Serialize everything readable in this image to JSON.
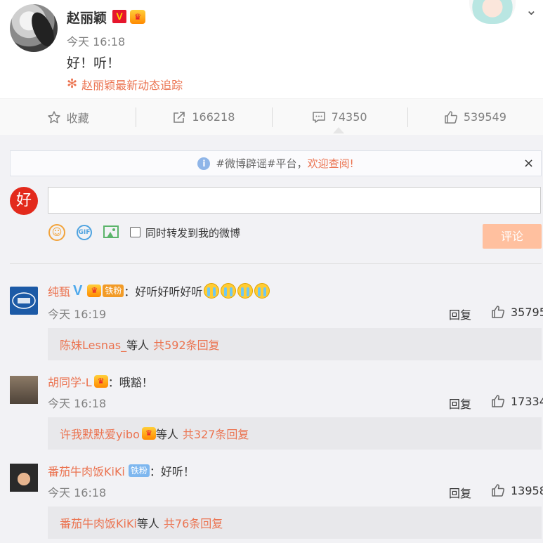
{
  "post": {
    "author": "赵丽颖",
    "v_badge": "V",
    "time": "今天 16:18",
    "text": "好！听！",
    "topic": "赵丽颖最新动态追踪"
  },
  "actions": {
    "favorite": "收藏",
    "repost": "166218",
    "comment": "74350",
    "like": "539549"
  },
  "notice": {
    "prefix": "#微博辟谣#平台，",
    "link": "欢迎查阅!",
    "close": "×"
  },
  "composer": {
    "my_avatar_text": "好",
    "gif_label": "GIF",
    "repost_label": "同时转发到我的微博",
    "submit_label": "评论"
  },
  "comments": [
    {
      "user": "纯甄",
      "badge_text": "铁粉",
      "text": "：好听好听好听",
      "time": "今天 16:19",
      "reply": "回复",
      "likes": "35795",
      "sub_user": "陈妹Lesnas_",
      "sub_mid": " 等人",
      "sub_count": "共592条回复"
    },
    {
      "user": "胡同学-L",
      "text": "：哦豁！",
      "time": "今天 16:18",
      "reply": "回复",
      "likes": "17334",
      "sub_user": "许我默默爱yibo",
      "sub_mid": " 等人",
      "sub_count": "共327条回复"
    },
    {
      "user": "番茄牛肉饭KiKi",
      "badge_text": "铁粉",
      "text": "：好听！",
      "time": "今天 16:18",
      "reply": "回复",
      "likes": "13958",
      "sub_user": "番茄牛肉饭KiKi",
      "sub_mid": " 等人",
      "sub_count": "共76条回复"
    }
  ],
  "colors": {
    "accent": "#eb7350",
    "submit_disabled": "#ffc09f",
    "comment_bg": "#f2f2f5"
  }
}
